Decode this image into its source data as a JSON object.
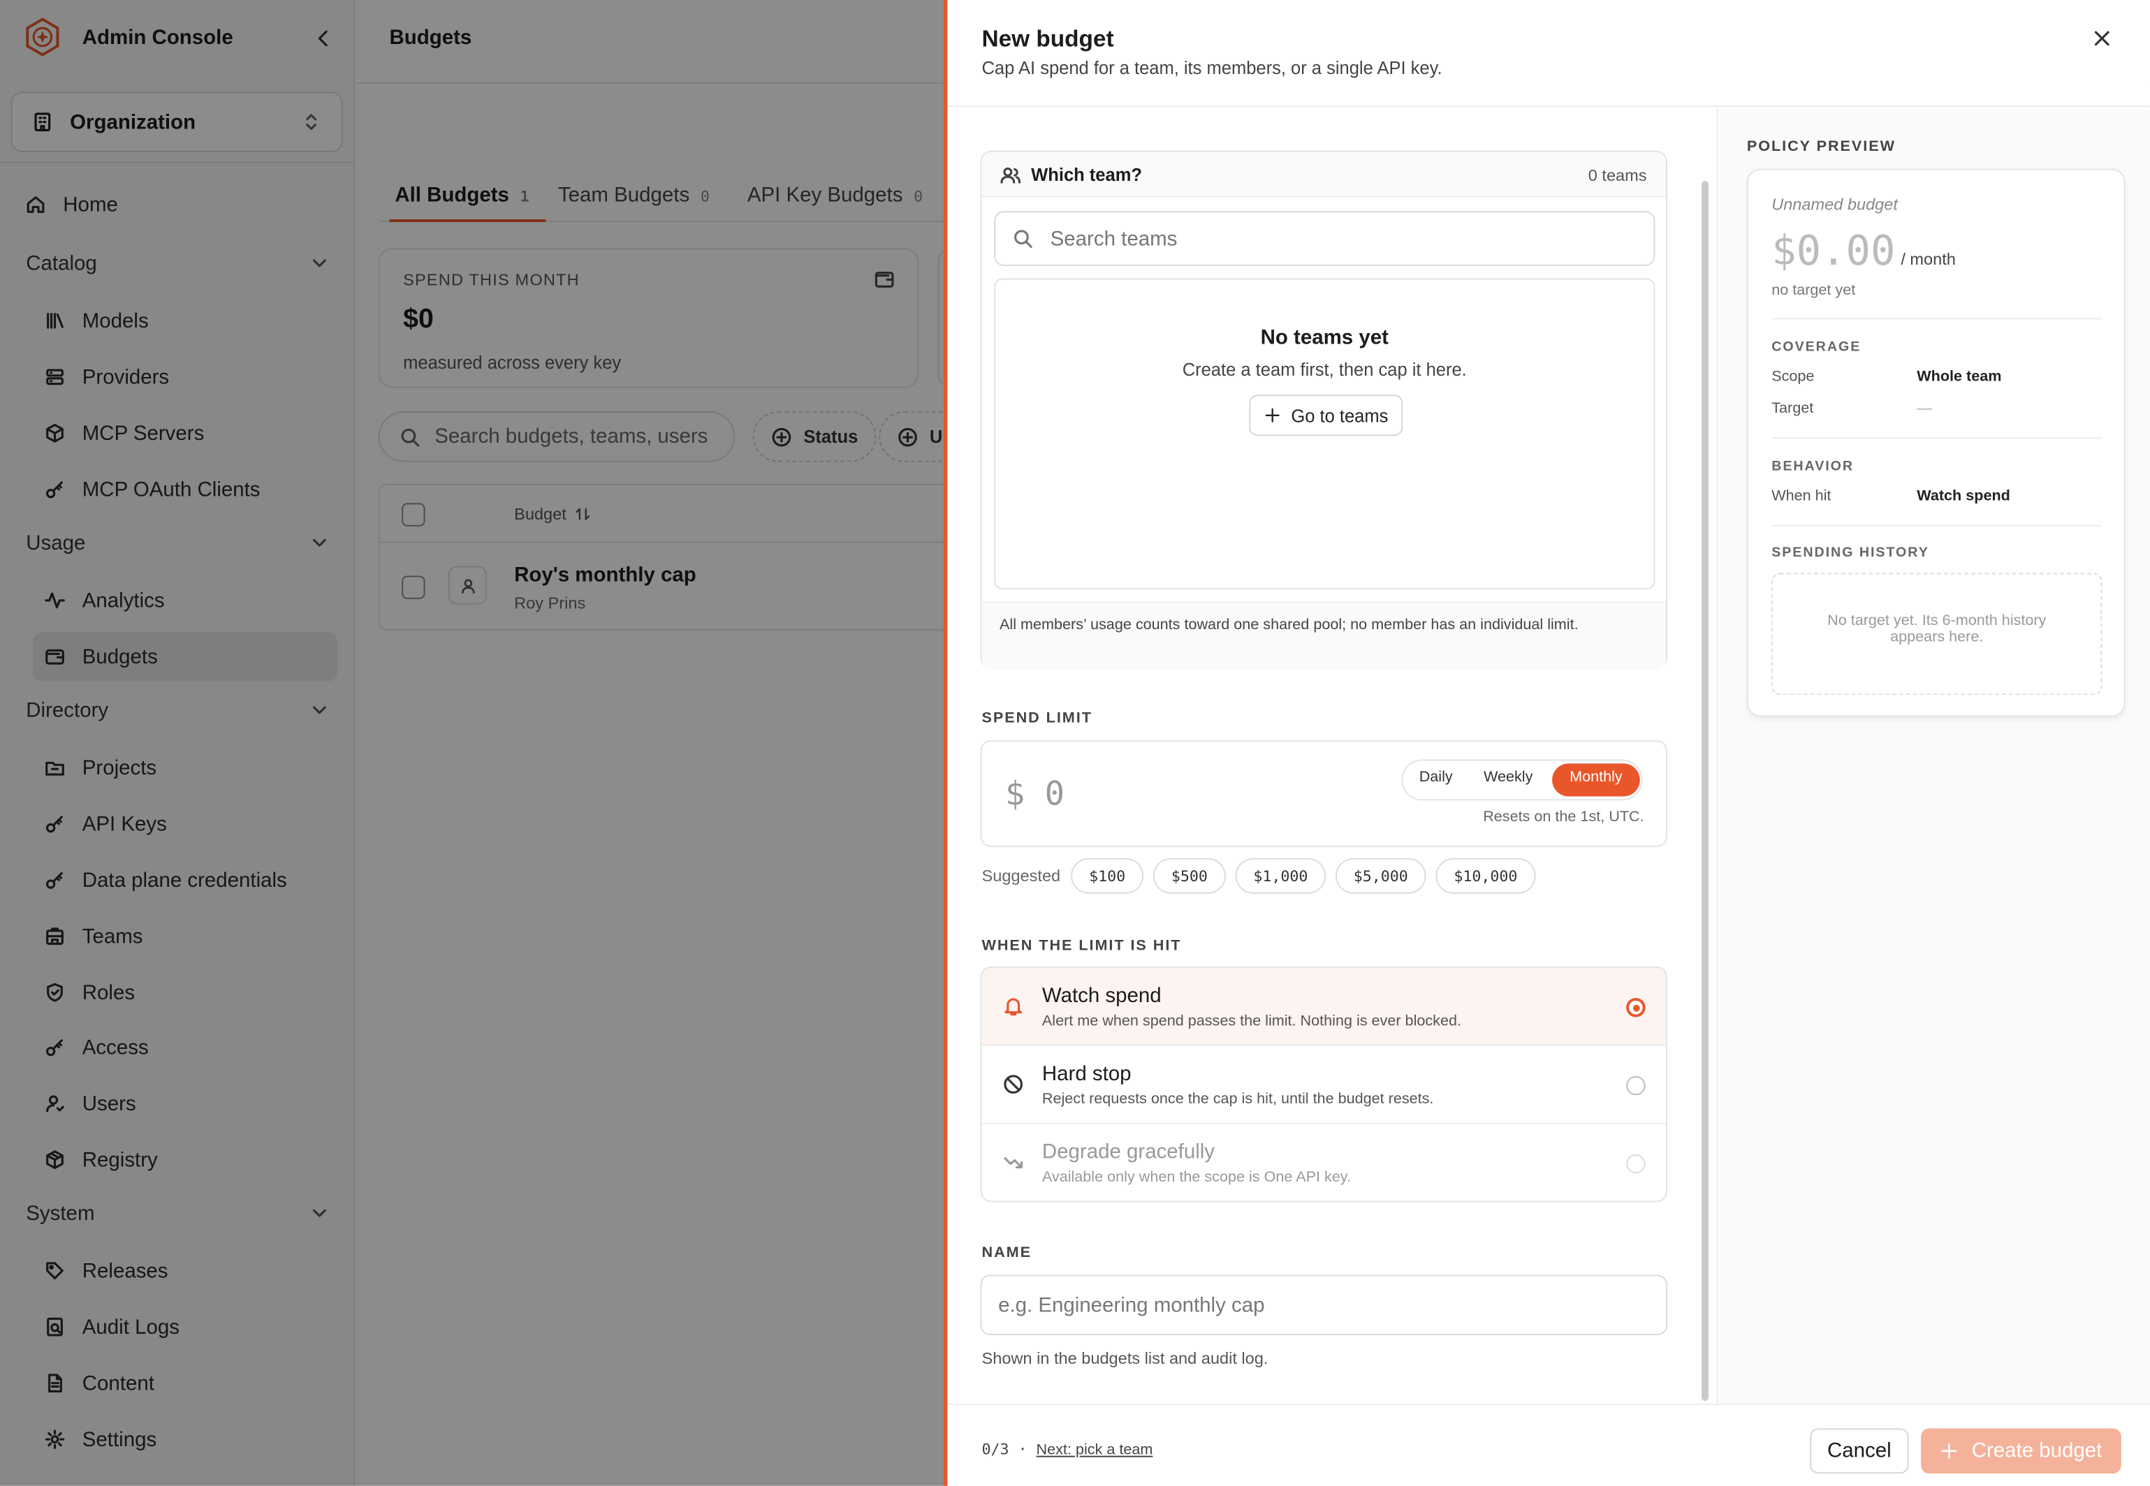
{
  "sidebar": {
    "app_title": "Admin Console",
    "org_label": "Organization",
    "items": [
      {
        "label": "Home",
        "icon": "home-icon"
      },
      {
        "group": "Catalog"
      },
      {
        "label": "Models",
        "icon": "library-icon"
      },
      {
        "label": "Providers",
        "icon": "server-icon"
      },
      {
        "label": "MCP Servers",
        "icon": "cube-icon"
      },
      {
        "label": "MCP OAuth Clients",
        "icon": "key-icon"
      },
      {
        "group": "Usage"
      },
      {
        "label": "Analytics",
        "icon": "activity-icon"
      },
      {
        "label": "Budgets",
        "icon": "wallet-icon",
        "active": true
      },
      {
        "group": "Directory"
      },
      {
        "label": "Projects",
        "icon": "folder-icon"
      },
      {
        "label": "API Keys",
        "icon": "key-icon"
      },
      {
        "label": "Data plane credentials",
        "icon": "key-icon"
      },
      {
        "label": "Teams",
        "icon": "building-icon"
      },
      {
        "label": "Roles",
        "icon": "shield-icon"
      },
      {
        "label": "Access",
        "icon": "key-icon"
      },
      {
        "label": "Users",
        "icon": "user-icon"
      },
      {
        "label": "Registry",
        "icon": "package-icon"
      },
      {
        "group": "System"
      },
      {
        "label": "Releases",
        "icon": "tag-icon"
      },
      {
        "label": "Audit Logs",
        "icon": "audit-icon"
      },
      {
        "label": "Content",
        "icon": "document-icon"
      },
      {
        "label": "Settings",
        "icon": "gear-icon"
      }
    ]
  },
  "main": {
    "title": "Budgets",
    "tabs": [
      {
        "label": "All Budgets",
        "count": "1"
      },
      {
        "label": "Team Budgets",
        "count": "0"
      },
      {
        "label": "API Key Budgets",
        "count": "0"
      }
    ],
    "spend_card": {
      "label": "SPEND THIS MONTH",
      "value": "$0",
      "sub": "measured across every key"
    },
    "search_placeholder": "Search budgets, teams, users",
    "filters": [
      "Status",
      "Us"
    ],
    "table": {
      "column": "Budget",
      "rows": [
        {
          "name": "Roy's monthly cap",
          "owner": "Roy Prins"
        }
      ]
    }
  },
  "panel": {
    "title": "New budget",
    "subtitle": "Cap AI spend for a team, its members, or a single API key.",
    "team_picker": {
      "label": "Which team?",
      "count": "0 teams",
      "search_placeholder": "Search teams",
      "empty_title": "No teams yet",
      "empty_sub": "Create a team first, then cap it here.",
      "go_button": "Go to teams",
      "footnote": "All members’ usage counts toward one shared pool; no member has an individual limit."
    },
    "spend_limit": {
      "label": "SPEND LIMIT",
      "currency": "$",
      "amount": "0",
      "periods": [
        "Daily",
        "Weekly",
        "Monthly"
      ],
      "selected_period": "Monthly",
      "reset_note": "Resets on the 1st, UTC.",
      "suggested_label": "Suggested",
      "suggested": [
        "$100",
        "$500",
        "$1,000",
        "$5,000",
        "$10,000"
      ]
    },
    "when_hit": {
      "label": "WHEN THE LIMIT IS HIT",
      "options": [
        {
          "title": "Watch spend",
          "desc": "Alert me when spend passes the limit. Nothing is ever blocked.",
          "selected": true
        },
        {
          "title": "Hard stop",
          "desc": "Reject requests once the cap is hit, until the budget resets.",
          "selected": false
        },
        {
          "title": "Degrade gracefully",
          "desc": "Available only when the scope is One API key.",
          "selected": false,
          "disabled": true
        }
      ]
    },
    "name": {
      "label": "NAME",
      "placeholder": "e.g. Engineering monthly cap",
      "hint": "Shown in the budgets list and audit log."
    },
    "preview": {
      "title": "POLICY PREVIEW",
      "name": "Unnamed budget",
      "amount": "$0.00",
      "per": "/ month",
      "target_note": "no target yet",
      "coverage_label": "COVERAGE",
      "scope_key": "Scope",
      "scope_val": "Whole team",
      "target_key": "Target",
      "target_val": "—",
      "behavior_label": "BEHAVIOR",
      "when_key": "When hit",
      "when_val": "Watch spend",
      "history_label": "SPENDING HISTORY",
      "history_note": "No target yet. Its 6-month history appears here."
    },
    "footer": {
      "step": "0/3 · ",
      "next": "Next: pick a team",
      "cancel": "Cancel",
      "create": "Create budget"
    }
  },
  "colors": {
    "accent": "#e8562a",
    "accent_disabled": "#f5b29b",
    "selected_bg": "#fdf3f0"
  }
}
